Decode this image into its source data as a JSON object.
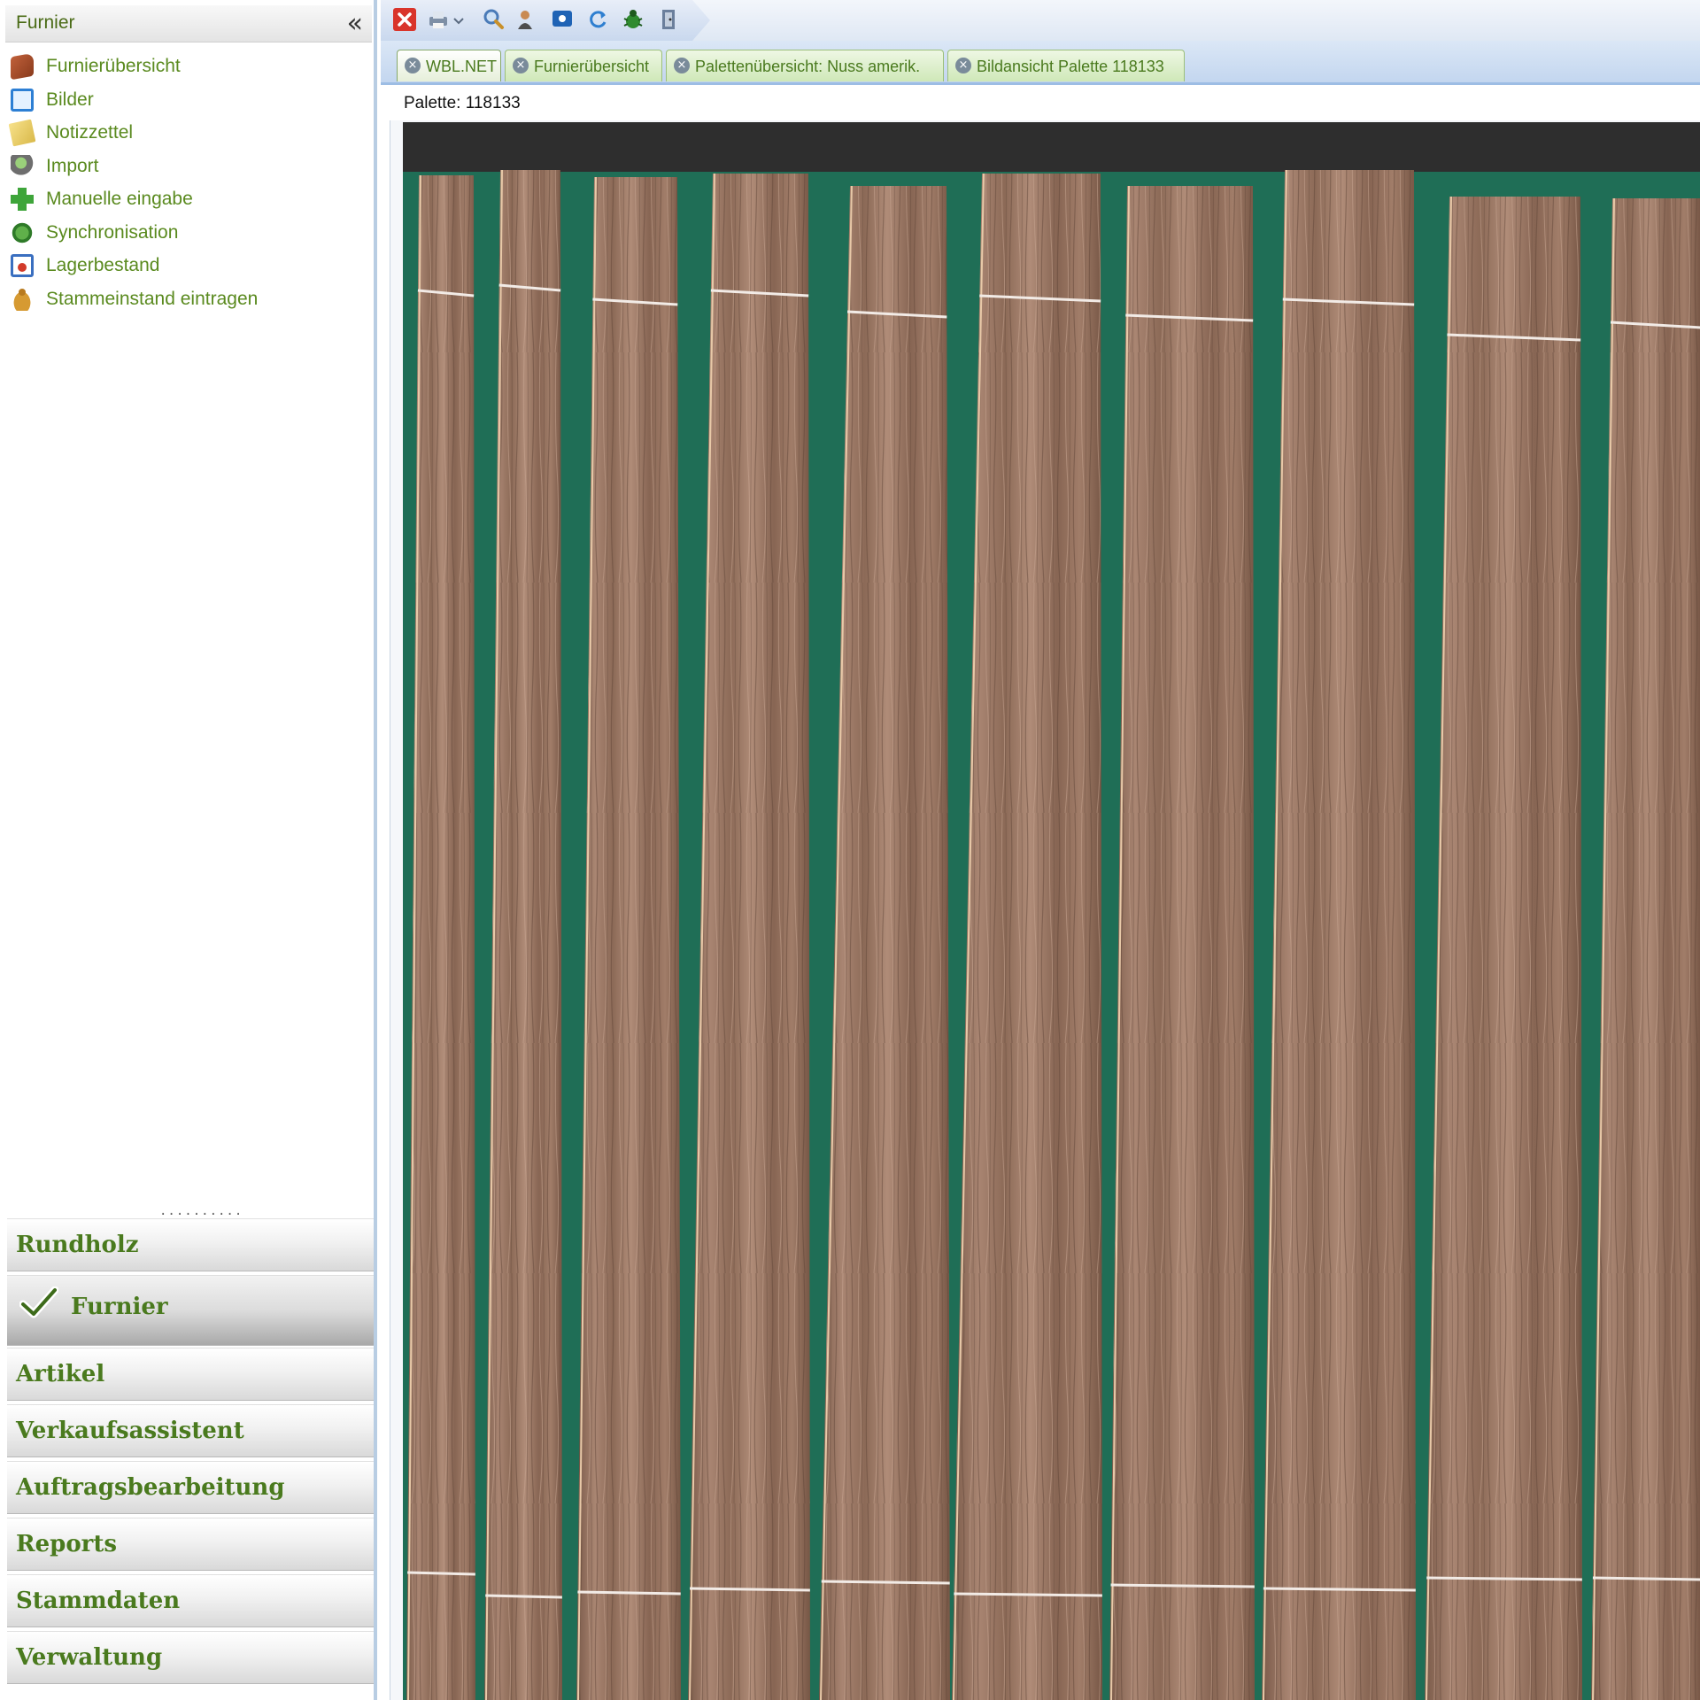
{
  "sidebar": {
    "title": "Furnier",
    "collapse_glyph": "«",
    "items": [
      {
        "label": "Furnierübersicht",
        "icon": "veneer-overview-icon"
      },
      {
        "label": "Bilder",
        "icon": "images-icon"
      },
      {
        "label": "Notizzettel",
        "icon": "notes-icon"
      },
      {
        "label": "Import",
        "icon": "import-icon"
      },
      {
        "label": "Manuelle eingabe",
        "icon": "add-icon"
      },
      {
        "label": "Synchronisation",
        "icon": "sync-icon"
      },
      {
        "label": "Lagerbestand",
        "icon": "stock-icon"
      },
      {
        "label": "Stammeinstand eintragen",
        "icon": "log-icon"
      }
    ],
    "splitter": "..........",
    "sections": [
      {
        "label": "Rundholz",
        "active": false
      },
      {
        "label": "Furnier",
        "active": true
      },
      {
        "label": "Artikel",
        "active": false
      },
      {
        "label": "Verkaufsassistent",
        "active": false
      },
      {
        "label": "Auftragsbearbeitung",
        "active": false
      },
      {
        "label": "Reports",
        "active": false
      },
      {
        "label": "Stammdaten",
        "active": false
      },
      {
        "label": "Verwaltung",
        "active": false
      }
    ]
  },
  "toolbar": {
    "icons": [
      "close-icon",
      "print-icon",
      "dropdown-arrow-icon",
      "search-icon",
      "user-icon",
      "screen-icon",
      "refresh-icon",
      "bug-icon",
      "exit-door-icon"
    ]
  },
  "tabs": [
    {
      "label": "WBL.NET",
      "active": true
    },
    {
      "label": "Furnierübersicht",
      "active": false
    },
    {
      "label": "Palettenübersicht: Nuss amerik.",
      "active": false
    },
    {
      "label": "Bildansicht Palette 118133",
      "active": false
    }
  ],
  "content": {
    "palette_label": "Palette: 118133"
  },
  "colors": {
    "accent_green": "#5a8a1f",
    "veneer_background": "#1f6e56",
    "top_band": "#2e2e2e",
    "wood_light": "#a5806c",
    "wood_dark": "#6f5142"
  }
}
